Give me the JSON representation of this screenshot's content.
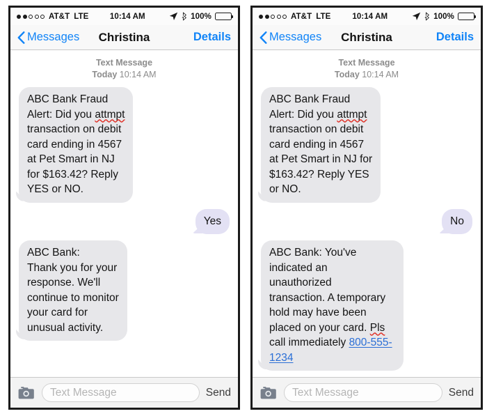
{
  "panels": [
    {
      "id": "left",
      "status": {
        "signal_filled": 2,
        "signal_empty": 3,
        "carrier": "AT&T",
        "network": "LTE",
        "time": "10:14 AM",
        "battery_percent": "100%",
        "location_icon": "location-arrow-icon",
        "bluetooth_icon": "bluetooth-icon",
        "battery_icon": "battery-full-icon"
      },
      "nav": {
        "back_icon": "chevron-left-icon",
        "back_label": "Messages",
        "title": "Christina",
        "details_label": "Details"
      },
      "thread": {
        "stamp_kind": "Text Message",
        "stamp_day": "Today",
        "stamp_time": "10:14 AM"
      },
      "messages": [
        {
          "direction": "in",
          "pre": "ABC Bank Fraud\nAlert: Did you ",
          "misspelled": "attmpt",
          "post": "\ntransaction on debit\ncard ending in 4567\nat Pet Smart in NJ\nfor $163.42? Reply\nYES or NO."
        },
        {
          "direction": "out",
          "text": "Yes"
        },
        {
          "direction": "in",
          "text": "ABC Bank:\nThank you for your\nresponse. We'll\ncontinue to monitor\nyour card for\nunusual activity."
        }
      ],
      "composer": {
        "camera_icon": "camera-icon",
        "placeholder": "Text Message",
        "send_label": "Send"
      }
    },
    {
      "id": "right",
      "status": {
        "signal_filled": 2,
        "signal_empty": 3,
        "carrier": "AT&T",
        "network": "LTE",
        "time": "10:14 AM",
        "battery_percent": "100%",
        "location_icon": "location-arrow-icon",
        "bluetooth_icon": "bluetooth-icon",
        "battery_icon": "battery-full-icon"
      },
      "nav": {
        "back_icon": "chevron-left-icon",
        "back_label": "Messages",
        "title": "Christina",
        "details_label": "Details"
      },
      "thread": {
        "stamp_kind": "Text Message",
        "stamp_day": "Today",
        "stamp_time": "10:14 AM"
      },
      "messages": [
        {
          "direction": "in",
          "pre": "ABC Bank Fraud\nAlert: Did you ",
          "misspelled": "attmpt",
          "post": "\ntransaction on debit\ncard ending in 4567\nat Pet Smart in NJ for\n$163.42? Reply YES\nor NO."
        },
        {
          "direction": "out",
          "text": "No"
        },
        {
          "direction": "in",
          "pre": "ABC Bank: You've\nindicated an\nunauthorized\ntransaction. A temporary\nhold may have been\nplaced on your card. ",
          "misspelled": "Pls",
          "post": "\ncall immediately ",
          "link": "800-555-1234"
        }
      ],
      "composer": {
        "camera_icon": "camera-icon",
        "placeholder": "Text Message",
        "send_label": "Send"
      }
    }
  ],
  "colors": {
    "received_bubble": "#e7e7ea",
    "sent_bubble": "#e3e1f4",
    "accent_blue": "#1184f7",
    "link_blue": "#2a6ed6",
    "spellcheck_red": "#e0372e",
    "stamp_gray": "#8c8c8c"
  }
}
